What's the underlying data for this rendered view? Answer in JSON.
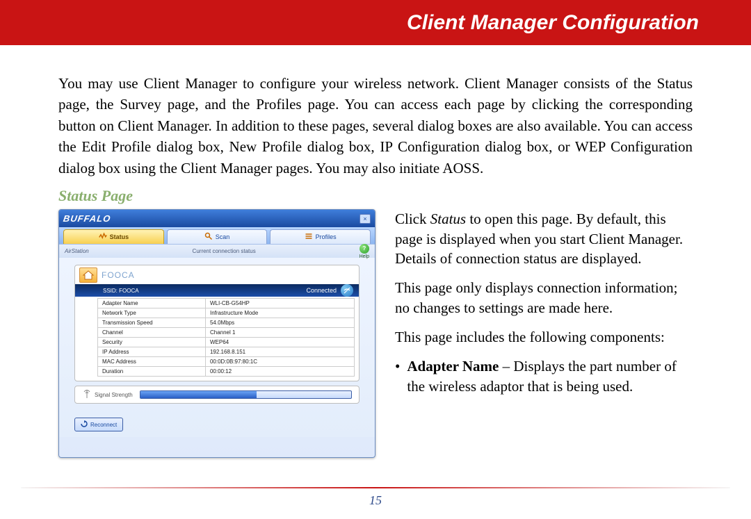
{
  "header": {
    "title": "Client Manager Configuration"
  },
  "intro": "You may use Client Manager to configure your wireless network. Client Manager consists of the Status page, the Survey page, and the Profiles page. You can access each page by clicking the corresponding button on Client Manager. In addition to these pages, several dialog boxes are also available. You can access the Edit Profile dialog box, New Profile dialog box, IP Configuration dialog box, or WEP Configuration dialog box using the Client Manager pages.  You may also initiate AOSS.",
  "section_title": "Status Page",
  "right": {
    "p1_a": "Click ",
    "p1_b": "Status",
    "p1_c": " to open this page. By default, this page is displayed when you start Client Manager. Details of connection status are displayed.",
    "p2": "This page only displays connection information; no changes to settings are made here.",
    "p3": "This page includes the following components:",
    "bullet_label": "Adapter Name",
    "bullet_text": " – Displays the part number of the wireless adaptor that is being used."
  },
  "page_number": "15",
  "app": {
    "brand": "BUFFALO",
    "close": "×",
    "tabs": {
      "status": "Status",
      "scan": "Scan",
      "profiles": "Profiles"
    },
    "subbar": {
      "left": "AirStation",
      "center": "Current connection status",
      "help": "?",
      "help_label": "Help"
    },
    "panel": {
      "title": "FOOCA",
      "ssid_label": "SSID: FOOCA",
      "status": "Connected",
      "rows": [
        {
          "k": "Adapter Name",
          "v": "WLI-CB-G54HP"
        },
        {
          "k": "Network Type",
          "v": "Infrastructure Mode"
        },
        {
          "k": "Transmission Speed",
          "v": "54.0Mbps"
        },
        {
          "k": "Channel",
          "v": "Channel 1"
        },
        {
          "k": "Security",
          "v": "WEP64"
        },
        {
          "k": "IP Address",
          "v": "192.168.8.151"
        },
        {
          "k": "MAC Address",
          "v": "00:0D:0B:97:80:1C"
        },
        {
          "k": "Duration",
          "v": "00:00:12"
        }
      ]
    },
    "signal_label": "Signal Strength",
    "reconnect": "Reconnect"
  }
}
